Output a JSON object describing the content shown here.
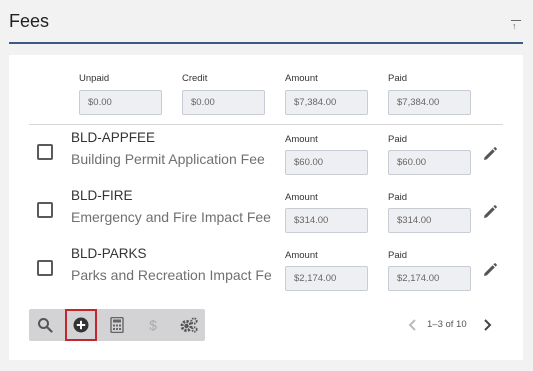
{
  "header": {
    "title": "Fees",
    "collapse_icon": "collapse-up-icon"
  },
  "summary": {
    "unpaid": {
      "label": "Unpaid",
      "value": "$0.00"
    },
    "credit": {
      "label": "Credit",
      "value": "$0.00"
    },
    "amount": {
      "label": "Amount",
      "value": "$7,384.00"
    },
    "paid": {
      "label": "Paid",
      "value": "$7,384.00"
    }
  },
  "fees": [
    {
      "code": "BLD-APPFEE",
      "description": "Building Permit Application Fee",
      "amount_label": "Amount",
      "amount": "$60.00",
      "paid_label": "Paid",
      "paid": "$60.00"
    },
    {
      "code": "BLD-FIRE",
      "description": "Emergency and Fire Impact Fee",
      "amount_label": "Amount",
      "amount": "$314.00",
      "paid_label": "Paid",
      "paid": "$314.00"
    },
    {
      "code": "BLD-PARKS",
      "description": "Parks and Recreation Impact Fee",
      "amount_label": "Amount",
      "amount": "$2,174.00",
      "paid_label": "Paid",
      "paid": "$2,174.00"
    }
  ],
  "toolbar": {
    "buttons": [
      "search-icon",
      "add-circle-icon",
      "calculator-icon",
      "dollar-icon",
      "settings-gears-icon"
    ],
    "selected": "add-circle-icon",
    "accent": "#c0282d"
  },
  "pager": {
    "text": "1–3 of 10"
  },
  "colors": {
    "header_rule": "#3b5b82",
    "background": "#f2f2f3",
    "card": "#ffffff"
  }
}
